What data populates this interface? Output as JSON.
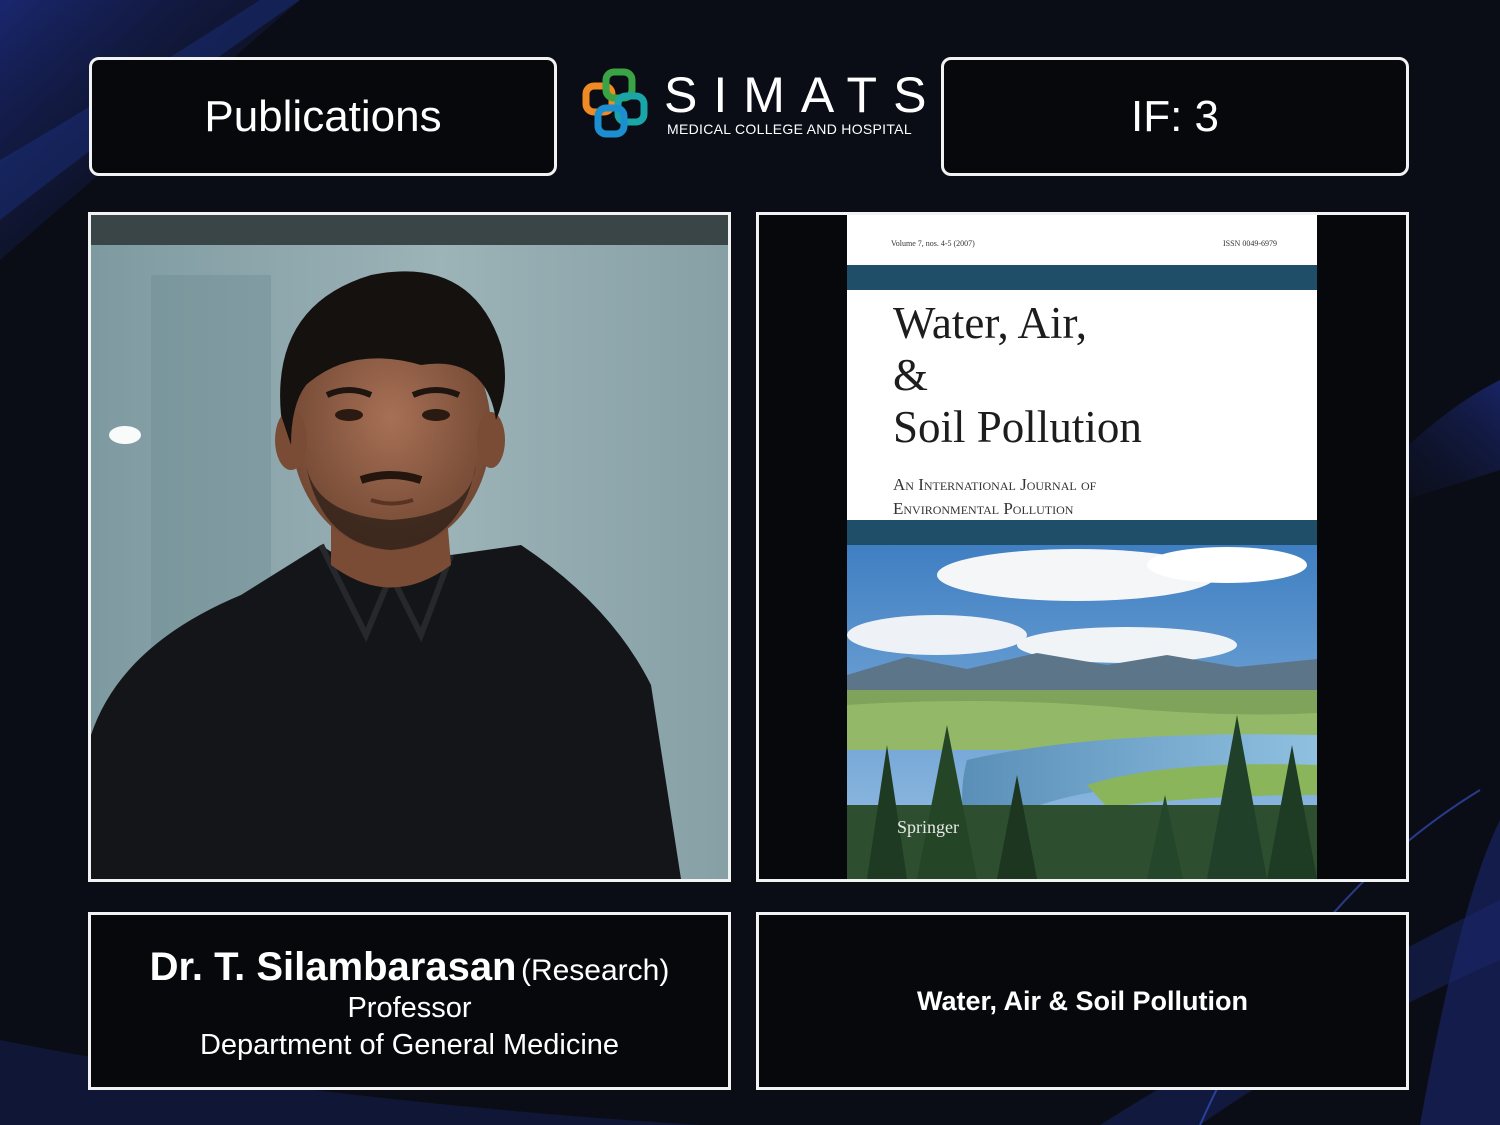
{
  "header": {
    "left_label": "Publications",
    "right_label": "IF: 3",
    "logo": {
      "wordmark": "SIMATS",
      "subtitle": "MEDICAL COLLEGE AND HOSPITAL",
      "colors": [
        "#f08a24",
        "#3aa346",
        "#1c8fd1",
        "#1aa5a8"
      ]
    }
  },
  "person": {
    "photo_icon": "portrait-photo",
    "name": "Dr. T. Silambarasan",
    "name_suffix": "(Research)",
    "title": "Professor",
    "department": "Department of General Medicine"
  },
  "journal": {
    "cover": {
      "volume_line": "Volume 7, nos. 4-5 (2007)",
      "issn_line": "ISSN 0049-6979",
      "title_line1": "Water, Air,",
      "title_line2": "&",
      "title_line3": "Soil Pollution",
      "subtitle_line1": "An International Journal of",
      "subtitle_line2": "Environmental Pollution",
      "publisher": "Springer"
    },
    "caption": "Water, Air & Soil Pollution"
  },
  "colors": {
    "background": "#0b0d16",
    "accent_blue": "#1a2a6e",
    "border": "#f2f2f2",
    "cover_bar": "#1f4e68"
  }
}
